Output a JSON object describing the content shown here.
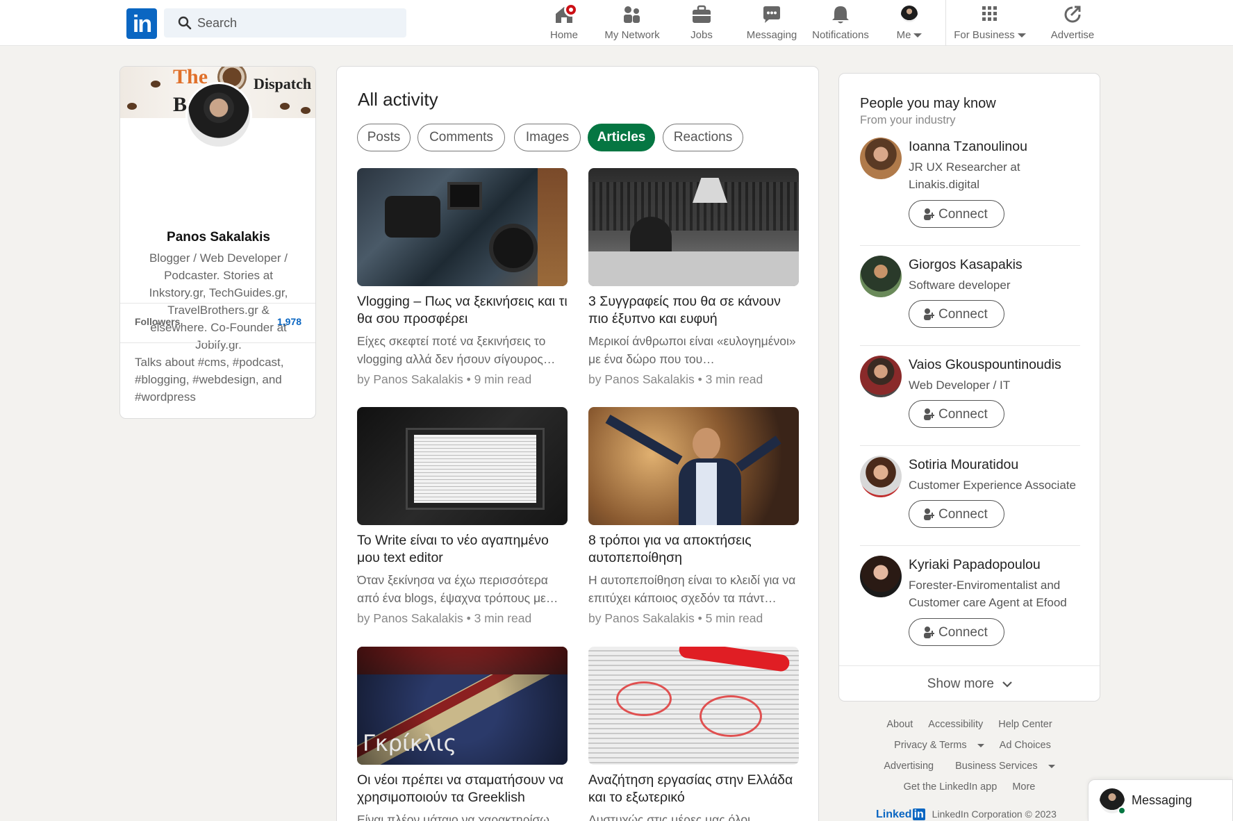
{
  "nav": {
    "search_placeholder": "Search",
    "items": [
      {
        "label": "Home",
        "icon": "home-icon"
      },
      {
        "label": "My Network",
        "icon": "network-icon"
      },
      {
        "label": "Jobs",
        "icon": "briefcase-icon"
      },
      {
        "label": "Messaging",
        "icon": "chat-icon"
      },
      {
        "label": "Notifications",
        "icon": "bell-icon"
      },
      {
        "label": "Me",
        "icon": "avatar"
      },
      {
        "label": "For Business",
        "icon": "grid-icon"
      },
      {
        "label": "Advertise",
        "icon": "advertise-icon"
      }
    ],
    "logo_text": "in"
  },
  "profile": {
    "cover_text": [
      "The",
      "Dispatch",
      "B",
      "g"
    ],
    "name": "Panos Sakalakis",
    "headline": "Blogger / Web Developer / Podcaster. Stories at Inkstory.gr, TechGuides.gr, TravelBrothers.gr & elsewhere. Co-Founder at Jobify.gr.",
    "followers_label": "Followers",
    "followers_count": "1,978",
    "talks_about": "Talks about #cms, #podcast, #blogging, #webdesign, and #wordpress"
  },
  "activity": {
    "title": "All activity",
    "tabs": [
      "Posts",
      "Comments",
      "Images",
      "Articles",
      "Reactions"
    ],
    "active_tab": "Articles",
    "articles": [
      {
        "title": "Vlogging – Πως να ξεκινήσεις και τι θα σου προσφέρει",
        "desc": "Είχες σκεφτεί ποτέ να ξεκινήσεις το vlogging αλλά δεν ήσουν σίγουρος…",
        "meta": "by Panos Sakalakis • 9 min read"
      },
      {
        "title": "3 Συγγραφείς που θα σε κάνουν πιο έξυπνο και ευφυή",
        "desc": "Μερικοί άνθρωποι είναι «ευλογημένοι» με ένα δώρο που του…",
        "meta": "by Panos Sakalakis • 3 min read"
      },
      {
        "title": "Το Write είναι το νέο αγαπημένο μου text editor",
        "desc": "Όταν ξεκίνησα να έχω περισσότερα από ένα blogs, έψαχνα τρόπους με…",
        "meta": "by Panos Sakalakis • 3 min read"
      },
      {
        "title": "8 τρόποι για να αποκτήσεις αυτοπεποίθηση",
        "desc": "Η αυτοπεποίθηση είναι το κλειδί για να επιτύχει κάποιος σχεδόν τα πάντ…",
        "meta": "by Panos Sakalakis • 5 min read"
      },
      {
        "title": "Οι νέοι πρέπει να σταματήσουν να χρησιμοποιούν τα Greeklish",
        "desc": "Είναι πλέον μάταιο να χαρακτηρίσω",
        "meta": "",
        "image_text": "Γκρίκλις"
      },
      {
        "title": "Αναζήτηση εργασίας στην Ελλάδα και το εξωτερικό",
        "desc": "Δυστυχώς στις μέρες μας όλοι",
        "meta": ""
      }
    ]
  },
  "people": {
    "title": "People you may know",
    "subtitle": "From your industry",
    "connect_label": "Connect",
    "list": [
      {
        "name": "Ioanna Tzanoulinou",
        "headline": "JR UX Researcher at Linakis.digital"
      },
      {
        "name": "Giorgos Kasapakis",
        "headline": "Software developer"
      },
      {
        "name": "Vaios Gkouspountinoudis",
        "headline": "Web Developer / IT"
      },
      {
        "name": "Sotiria Mouratidou",
        "headline": "Customer Experience Associate"
      },
      {
        "name": "Kyriaki Papadopoulou",
        "headline": "Forester-Enviromentalist and Customer care Agent at Efood"
      }
    ],
    "show_more": "Show more"
  },
  "footer": {
    "links": [
      "About",
      "Accessibility",
      "Help Center",
      "Privacy & Terms",
      "Ad Choices",
      "Advertising",
      "Business Services",
      "Get the LinkedIn app",
      "More"
    ],
    "brand": "Linked",
    "brand_in": "in",
    "copyright": "LinkedIn Corporation © 2023"
  },
  "messaging": {
    "label": "Messaging"
  },
  "colors": {
    "brand_blue": "#0a66c2",
    "active_green": "#057642",
    "notification_red": "#cc1016"
  }
}
